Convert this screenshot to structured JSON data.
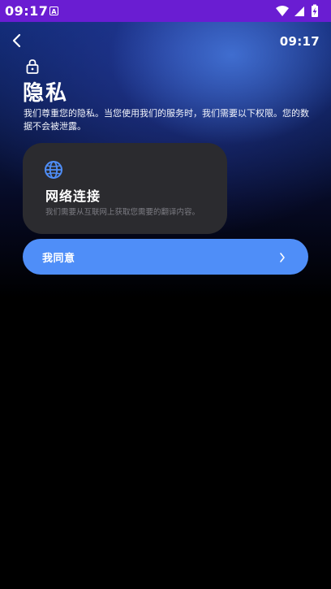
{
  "status_bar": {
    "time": "09:17",
    "indicator_letter": "A",
    "icons": [
      "wifi-icon",
      "signal-icon",
      "battery-charging-icon"
    ]
  },
  "header": {
    "back_icon": "chevron-left-icon",
    "clock": "09:17"
  },
  "privacy": {
    "lock_icon": "lock-icon",
    "title": "隐私",
    "description": "我们尊重您的隐私。当您使用我们的服务时，我们需要以下权限。您的数据不会被泄露。"
  },
  "permission_card": {
    "icon": "globe-icon",
    "title": "网络连接",
    "description": "我们需要从互联网上获取您需要的翻译内容。"
  },
  "agree_button": {
    "label": "我同意",
    "icon": "chevron-right-icon"
  },
  "colors": {
    "status_bar": "#6a1dd2",
    "accent_button": "#4f8ef8",
    "card_background": "#2b2b2f",
    "globe_icon": "#4f8ef8",
    "background": "#000000"
  }
}
